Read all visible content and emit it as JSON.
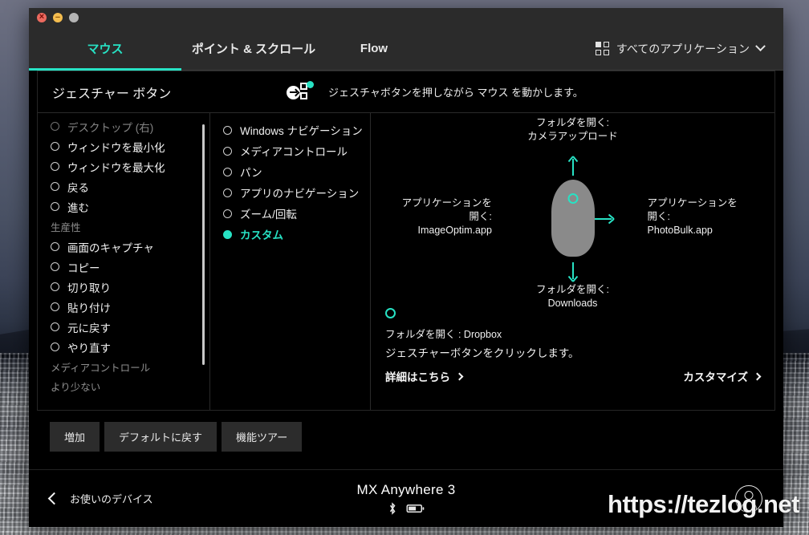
{
  "window": {
    "controls": [
      "close",
      "minimize",
      "maximize"
    ]
  },
  "tabs": [
    {
      "label": "マウス",
      "active": true
    },
    {
      "label": "ポイント & スクロール",
      "active": false
    },
    {
      "label": "Flow",
      "active": false
    }
  ],
  "app_filter": {
    "label": "すべてのアプリケーション",
    "icon": "grid-icon",
    "chevron": "chevron-down-icon"
  },
  "panel": {
    "title": "ジェスチャー ボタン",
    "icon": "gesture-button-icon",
    "description": "ジェスチャボタンを押しながら マウス を動かします。"
  },
  "left_list": {
    "items": [
      {
        "label": "デスクトップ (右)",
        "selected": false,
        "clipped": true
      },
      {
        "label": "ウィンドウを最小化",
        "selected": false
      },
      {
        "label": "ウィンドウを最大化",
        "selected": false
      },
      {
        "label": "戻る",
        "selected": false
      },
      {
        "label": "進む",
        "selected": false
      }
    ],
    "group_label_1": "生産性",
    "items2": [
      {
        "label": "画面のキャプチャ",
        "selected": false
      },
      {
        "label": "コピー",
        "selected": false
      },
      {
        "label": "切り取り",
        "selected": false
      },
      {
        "label": "貼り付け",
        "selected": false
      },
      {
        "label": "元に戻す",
        "selected": false
      },
      {
        "label": "やり直す",
        "selected": false
      }
    ],
    "group_label_2": "メディアコントロール",
    "less_label": "より少ない"
  },
  "mid_list": {
    "items": [
      {
        "label": "Windows ナビゲーション",
        "selected": false
      },
      {
        "label": "メディアコントロール",
        "selected": false
      },
      {
        "label": "パン",
        "selected": false
      },
      {
        "label": "アプリのナビゲーション",
        "selected": false
      },
      {
        "label": "ズーム/回転",
        "selected": false
      },
      {
        "label": "カスタム",
        "selected": true
      }
    ]
  },
  "diagram": {
    "up": {
      "line1": "フォルダを開く:",
      "line2": "カメラアップロード",
      "arrow": "arrow-up-icon"
    },
    "down": {
      "line1": "フォルダを開く:",
      "line2": "Downloads",
      "arrow": "arrow-down-icon"
    },
    "left": {
      "line1": "アプリケーションを",
      "line2": "開く:",
      "line3": "ImageOptim.app",
      "arrow": "arrow-left-icon"
    },
    "right": {
      "line1": "アプリケーションを",
      "line2": "開く:",
      "line3": "PhotoBulk.app",
      "arrow": "arrow-right-icon"
    },
    "click": {
      "icon": "click-circle-icon",
      "line1": "フォルダを開く : Dropbox",
      "line2": "ジェスチャーボタンをクリックします。"
    }
  },
  "links": {
    "more": "詳細はこちら",
    "customize": "カスタマイズ"
  },
  "action_buttons": [
    {
      "label": "増加"
    },
    {
      "label": "デフォルトに戻す"
    },
    {
      "label": "機能ツアー"
    }
  ],
  "footer": {
    "back_label": "お使いのデバイス",
    "device_name": "MX Anywhere 3",
    "bluetooth_icon": "bluetooth-icon",
    "battery_icon": "battery-icon",
    "account_icon": "account-avatar-icon"
  },
  "watermark": "https://tezlog.net",
  "colors": {
    "accent": "#27e2c4",
    "window_bg": "#000000",
    "chrome_bg": "#2b2b2b",
    "button_bg": "#2c2c2c"
  }
}
